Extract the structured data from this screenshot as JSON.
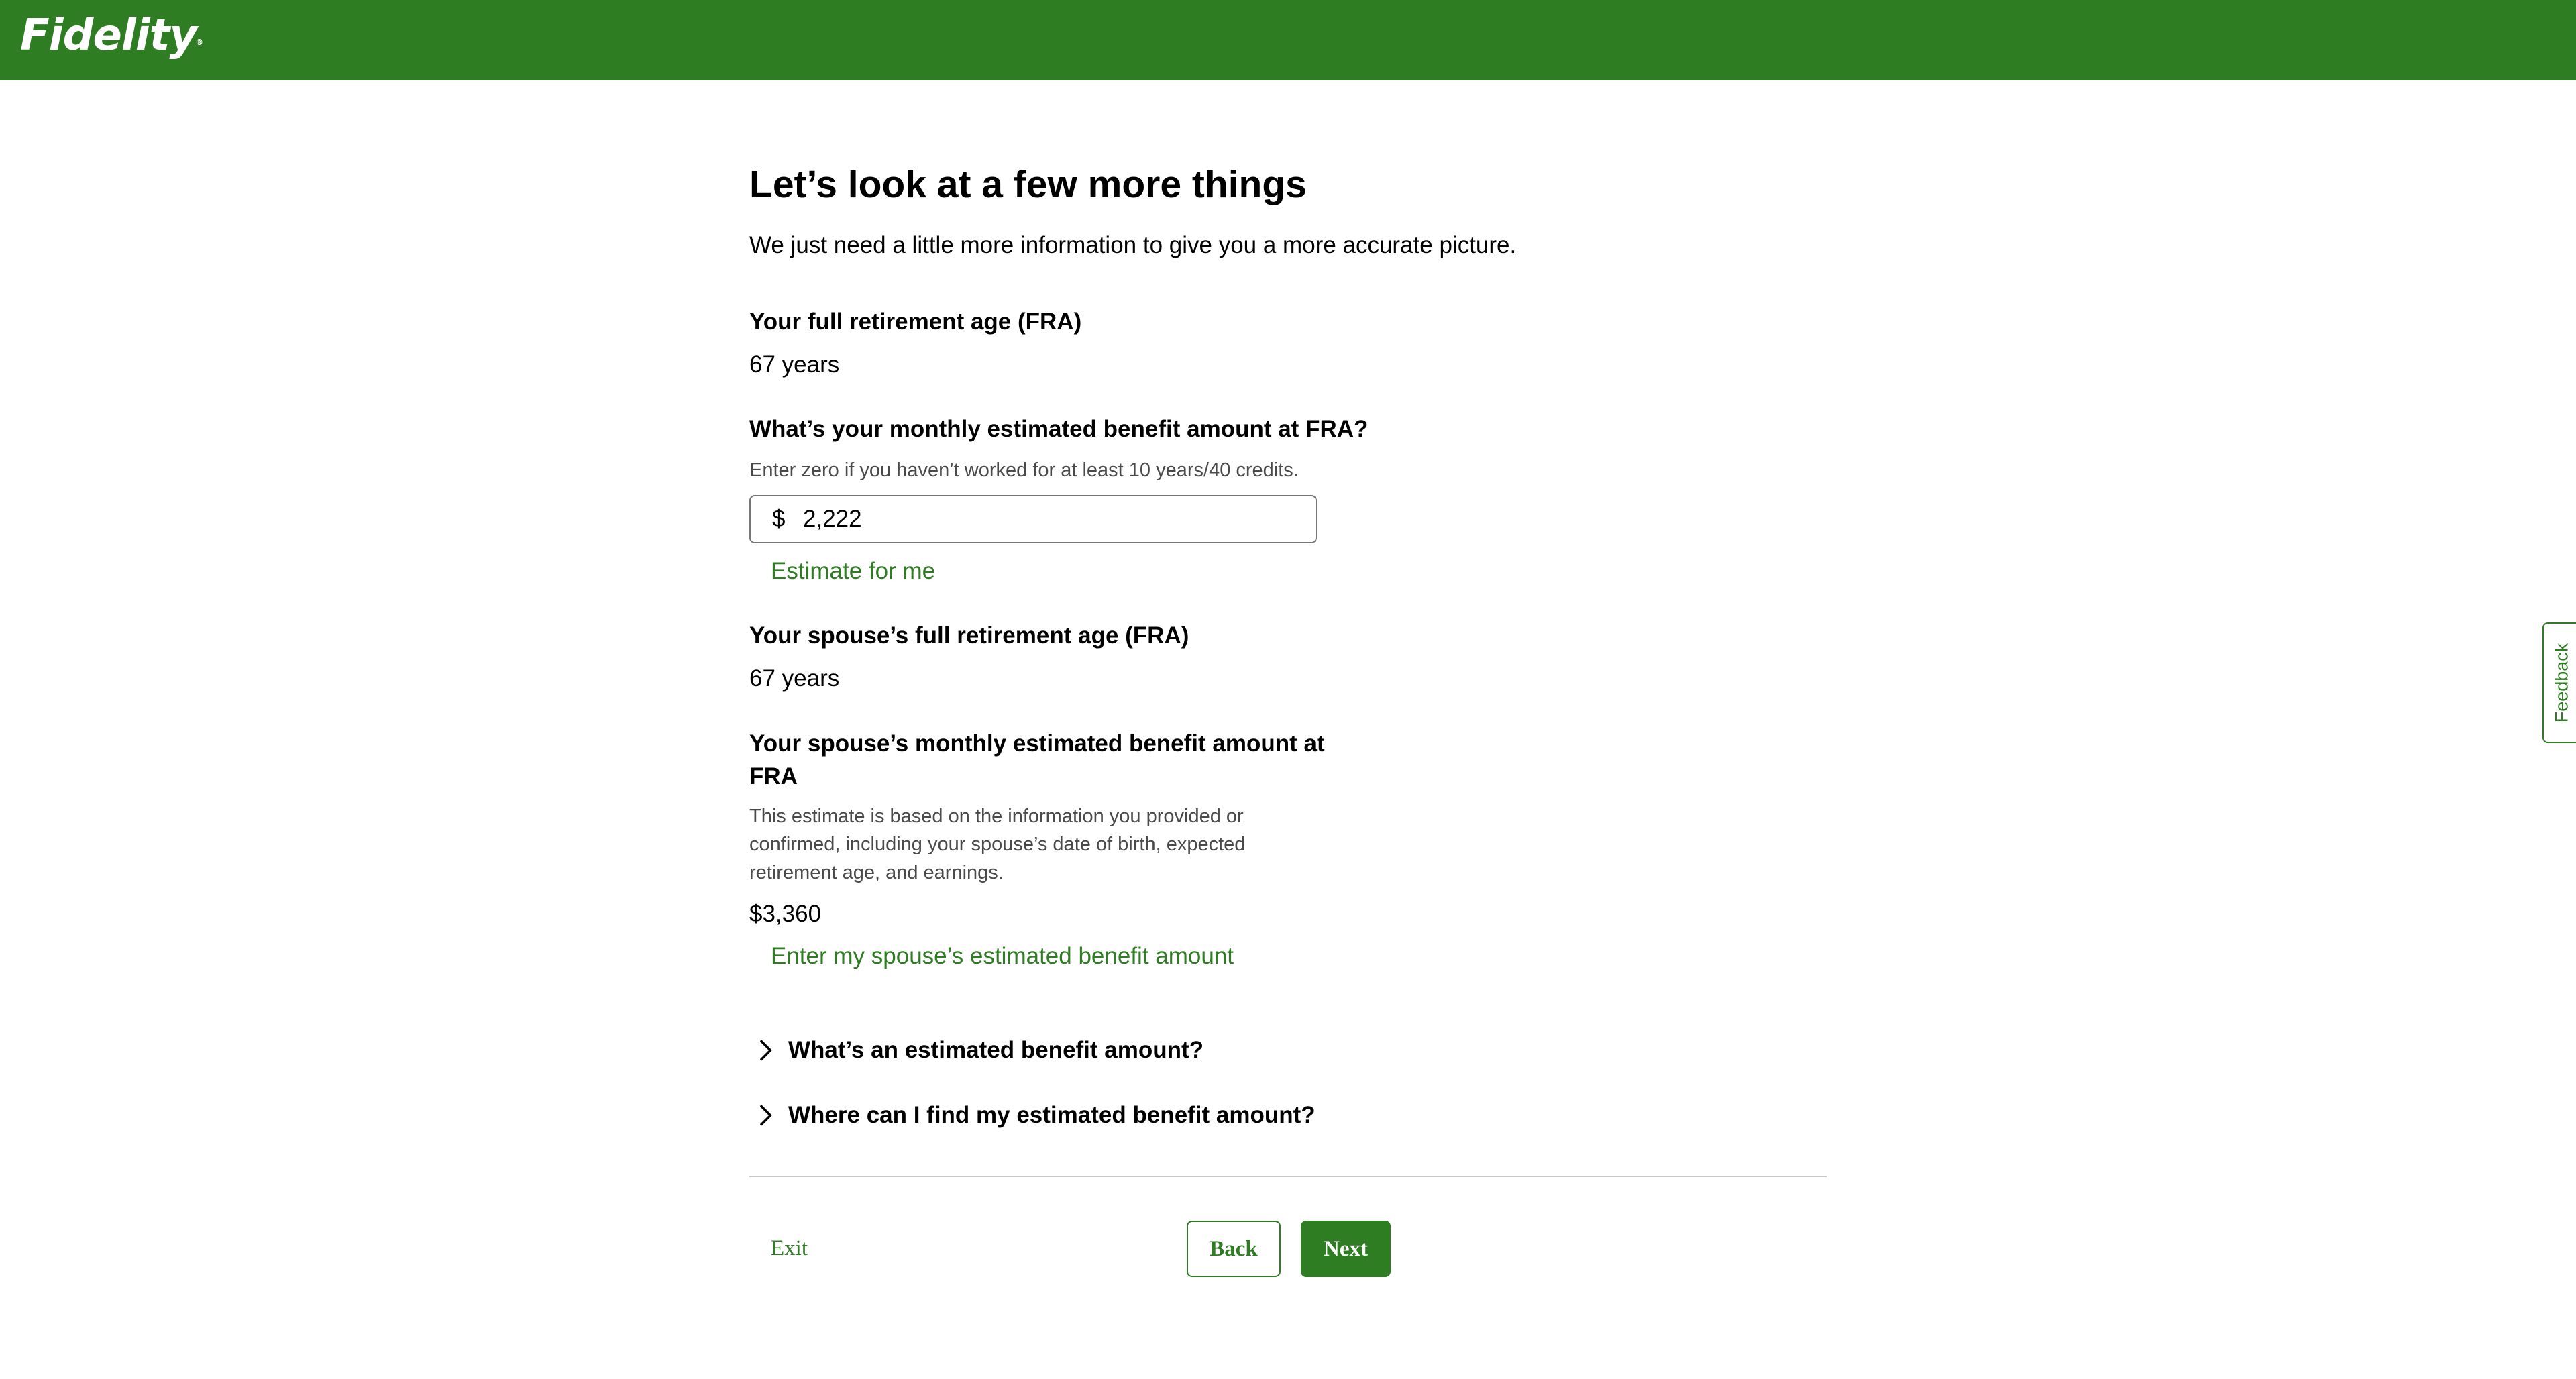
{
  "header": {
    "logo_text": "Fidelity",
    "logo_mark": "®",
    "brand_color": "#2f7d23"
  },
  "main": {
    "title": "Let’s look at a few more things",
    "subtitle": "We just need a little more information to give you a more accurate picture.",
    "fra": {
      "label": "Your full retirement age (FRA)",
      "value": "67 years"
    },
    "benefit": {
      "label": "What’s your monthly estimated benefit amount at FRA?",
      "hint": "Enter zero if you haven’t worked for at least 10 years/40 credits.",
      "prefix": "$",
      "value": "2,222",
      "estimate_link": "Estimate for me"
    },
    "spouse_fra": {
      "label": "Your spouse’s full retirement age (FRA)",
      "value": "67 years"
    },
    "spouse_benefit": {
      "label": "Your spouse’s monthly estimated benefit amount at FRA",
      "hint": "This estimate is based on the information you provided or confirmed, including your spouse’s date of birth, expected retirement age, and earnings.",
      "value": "$3,360",
      "enter_link": "Enter my spouse’s estimated benefit amount"
    },
    "accordions": [
      {
        "label": "What’s an estimated benefit amount?",
        "icon": "chevron-right-icon"
      },
      {
        "label": "Where can I find my estimated benefit amount?",
        "icon": "chevron-right-icon"
      }
    ]
  },
  "footer": {
    "exit_label": "Exit",
    "back_label": "Back",
    "next_label": "Next"
  },
  "feedback": {
    "label": "Feedback"
  }
}
